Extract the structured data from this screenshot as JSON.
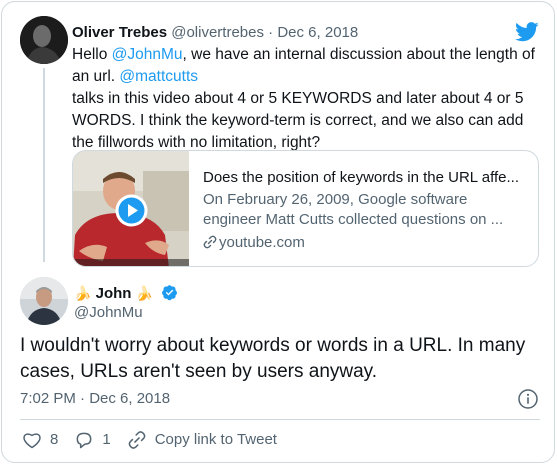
{
  "parent_tweet": {
    "author_name": "Oliver Trebes",
    "author_handle": "@olivertrebes",
    "separator": "·",
    "date": "Dec 6, 2018",
    "text_line1_pre": "Hello ",
    "text_line1_mention": "@JohnMu",
    "text_line1_post": ", we have an internal discussion about the length of",
    "text_line2_pre": "an url. ",
    "text_line2_mention": "@mattcutts",
    "text_line3": "talks in this video about 4 or 5 KEYWORDS and later about 4 or 5",
    "text_line4": "WORDS. I think  the keyword-term is correct, and we also can add",
    "text_line5": "the fillwords with no limitation, right?"
  },
  "link_card": {
    "title": "Does the position of keywords in the URL affe...",
    "description_line1": "On February 26, 2009, Google software",
    "description_line2": "engineer Matt Cutts collected questions on ...",
    "domain": "youtube.com"
  },
  "main_tweet": {
    "author_name": "John",
    "name_emoji": "🍌",
    "author_handle": "@JohnMu",
    "text_line1": "I wouldn't worry about keywords or words in a URL. In many",
    "text_line2": "cases, URLs aren't seen by users anyway.",
    "timestamp": "7:02 PM · Dec 6, 2018",
    "likes": "8",
    "replies": "1",
    "copy_link_label": "Copy link to Tweet"
  },
  "colors": {
    "accent": "#1d9bf0",
    "muted_text": "#536471",
    "border": "#cfd9de",
    "heart": "#536471"
  },
  "icons": {
    "brand": "twitter-bird-icon",
    "play": "play-icon",
    "link": "link-icon",
    "verified": "verified-badge-icon",
    "info": "info-icon",
    "like": "heart-icon",
    "reply": "reply-icon",
    "copy": "link-icon"
  }
}
